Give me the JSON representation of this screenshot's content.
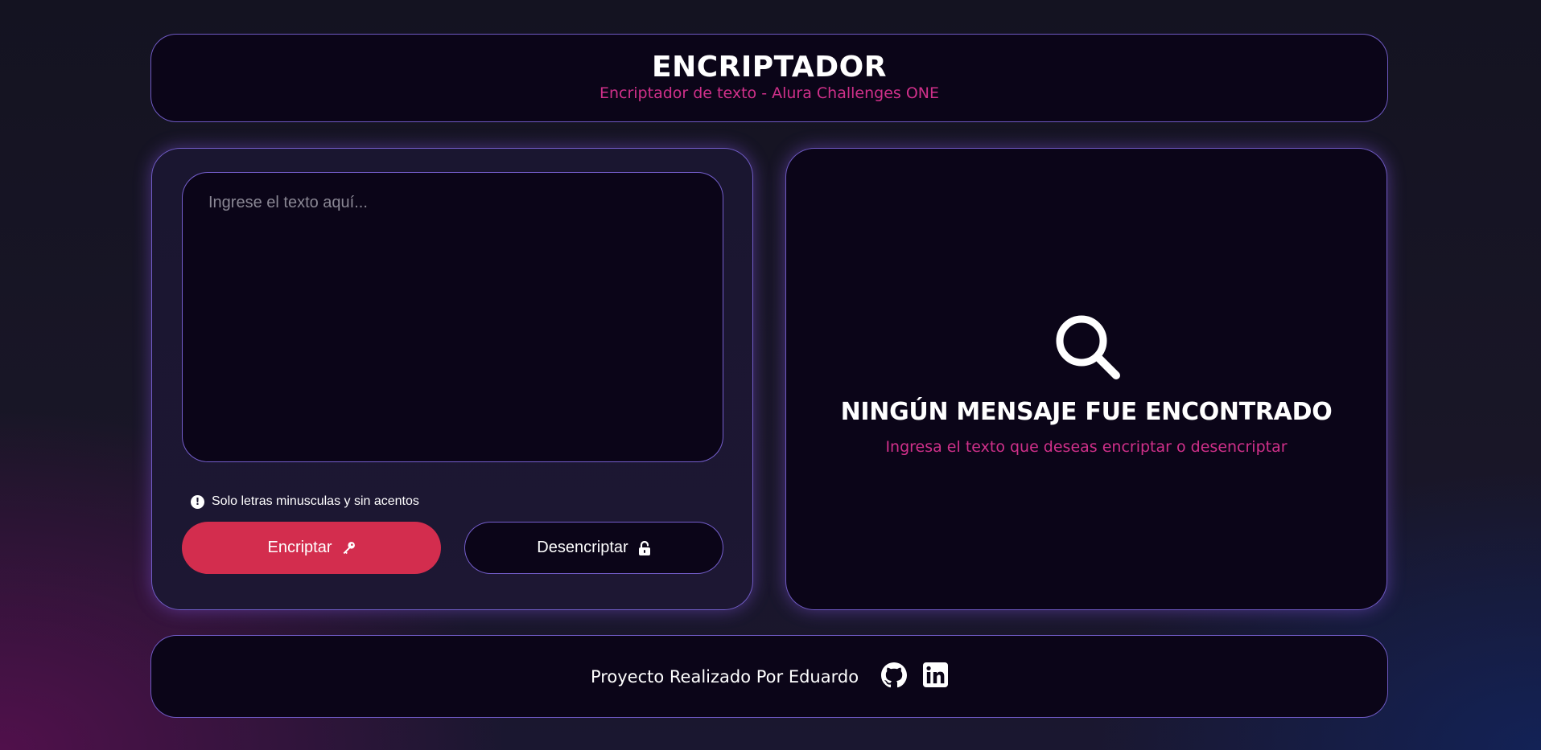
{
  "header": {
    "title": "ENCRIPTADOR",
    "subtitle": "Encriptador de texto - Alura Challenges ONE"
  },
  "input": {
    "placeholder": "Ingrese el texto aquí...",
    "value": "",
    "hint_icon": "exclamation-circle-icon",
    "hint": "Solo letras minusculas y sin acentos"
  },
  "buttons": {
    "encrypt_label": "Encriptar",
    "encrypt_icon": "key-icon",
    "decrypt_label": "Desencriptar",
    "decrypt_icon": "unlock-icon"
  },
  "output": {
    "icon": "search-icon",
    "title": "NINGÚN MENSAJE FUE ENCONTRADO",
    "subtitle": "Ingresa el texto que deseas encriptar o desencriptar"
  },
  "footer": {
    "text": "Proyecto Realizado Por Eduardo",
    "links": [
      {
        "icon": "github-icon"
      },
      {
        "icon": "linkedin-icon"
      }
    ]
  },
  "colors": {
    "accent_pink": "#d0308a",
    "button_red": "#d32d4e",
    "border_purple": "#8068e0",
    "panel_bg": "#0b0518"
  }
}
